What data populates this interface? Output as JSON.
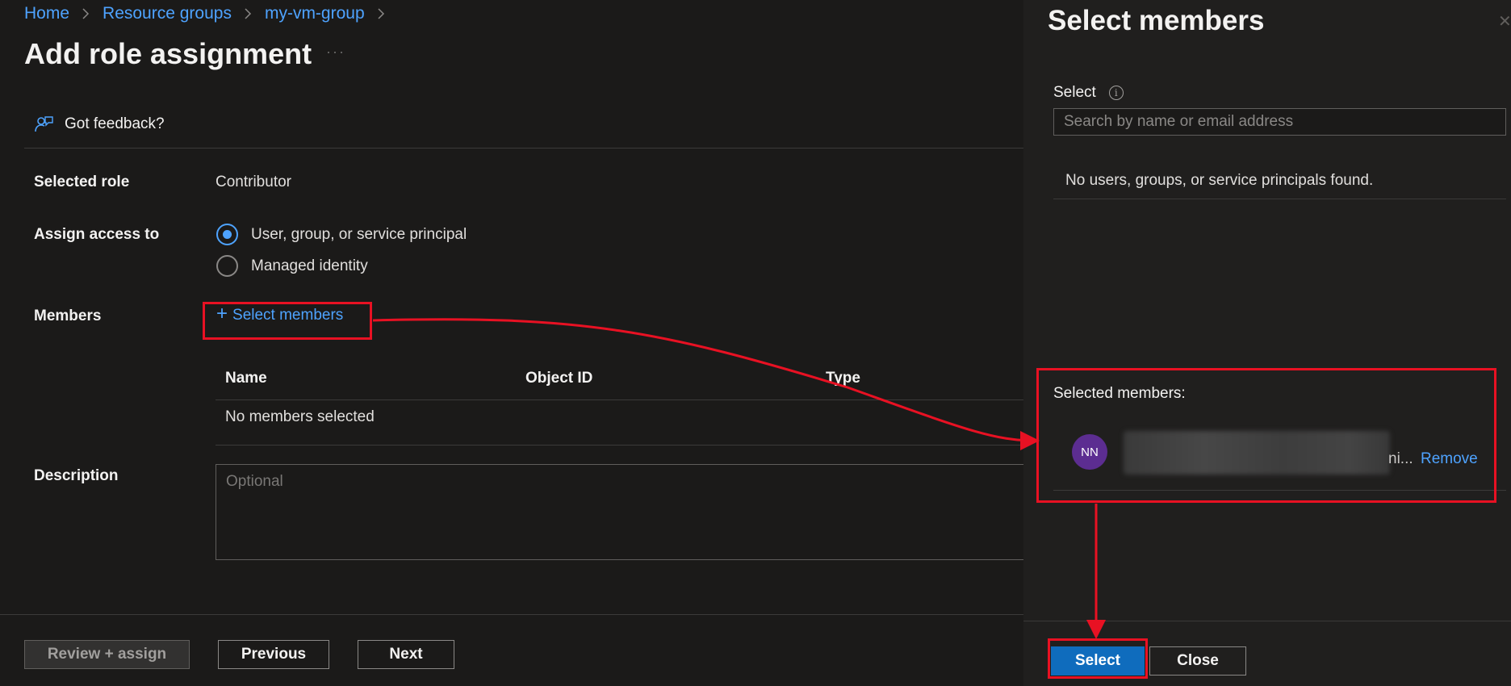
{
  "breadcrumb": [
    "Home",
    "Resource groups",
    "my-vm-group"
  ],
  "page": {
    "title": "Add role assignment",
    "more": "···",
    "feedback": "Got feedback?"
  },
  "form": {
    "selected_role_label": "Selected role",
    "selected_role_value": "Contributor",
    "assign_access_label": "Assign access to",
    "assign_options": [
      {
        "label": "User, group, or service principal",
        "selected": true
      },
      {
        "label": "Managed identity",
        "selected": false
      }
    ],
    "members_label": "Members",
    "select_members_link": "Select members",
    "table": {
      "columns": [
        "Name",
        "Object ID",
        "Type"
      ],
      "empty_text": "No members selected"
    },
    "description_label": "Description",
    "description_placeholder": "Optional"
  },
  "footer": {
    "review_assign": "Review + assign",
    "previous": "Previous",
    "next": "Next"
  },
  "panel": {
    "title": "Select members",
    "select_label": "Select",
    "search_placeholder": "Search by name or email address",
    "no_results": "No users, groups, or service principals found.",
    "selected_members_label": "Selected members:",
    "member": {
      "initials": "NN",
      "name_tail": "ni...",
      "remove": "Remove"
    },
    "select_button": "Select",
    "close_button": "Close"
  },
  "colors": {
    "accent": "#4ea3ff",
    "primary_button": "#0f6cbd",
    "annotation": "#e81123",
    "avatar": "#5c2d91"
  }
}
